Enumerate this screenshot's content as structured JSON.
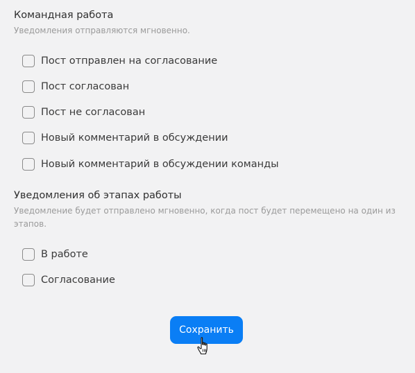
{
  "team_section": {
    "title": "Командная работа",
    "subtitle": "Уведомления отправляются мгновенно.",
    "options": [
      {
        "label": "Пост отправлен на согласование",
        "checked": false
      },
      {
        "label": "Пост согласован",
        "checked": false
      },
      {
        "label": "Пост не согласован",
        "checked": false
      },
      {
        "label": "Новый комментарий в обсуждении",
        "checked": false
      },
      {
        "label": "Новый комментарий в обсуждении команды",
        "checked": false
      }
    ]
  },
  "stages_section": {
    "title": "Уведомления об этапах работы",
    "subtitle": "Уведомление будет отправлено мгновенно, когда пост будет перемещено на один из этапов.",
    "options": [
      {
        "label": "В работе",
        "checked": false
      },
      {
        "label": "Согласование",
        "checked": false
      }
    ]
  },
  "actions": {
    "save_label": "Сохранить"
  },
  "colors": {
    "accent": "#0a7ef5",
    "background": "#f2f2f3"
  }
}
